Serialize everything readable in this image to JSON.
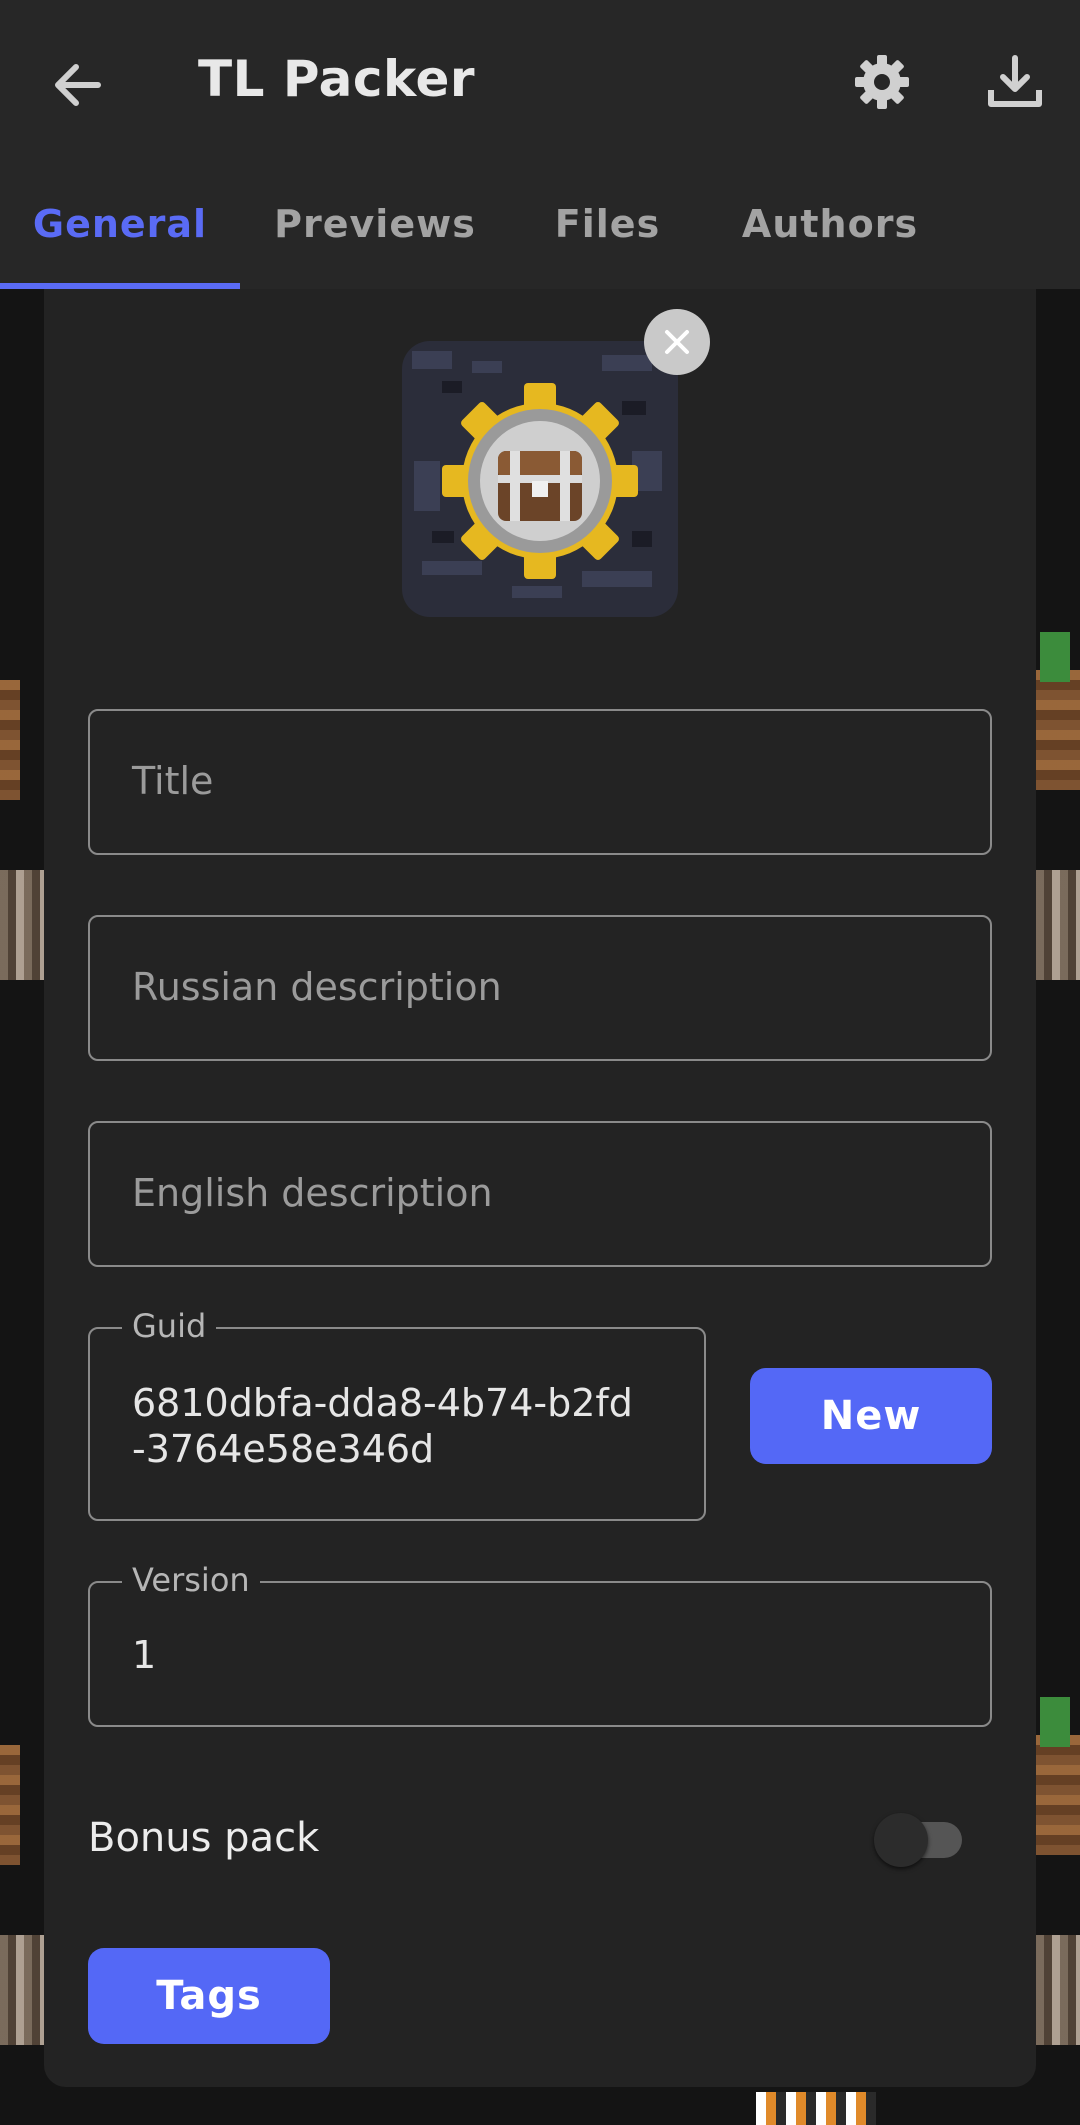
{
  "appbar": {
    "title": "TL Packer",
    "icons": [
      "back-arrow-icon",
      "gear-icon",
      "download-icon"
    ]
  },
  "tabs": [
    {
      "label": "General",
      "active": true
    },
    {
      "label": "Previews",
      "active": false
    },
    {
      "label": "Files",
      "active": false
    },
    {
      "label": "Authors",
      "active": false
    }
  ],
  "form": {
    "title_placeholder": "Title",
    "russian_description_placeholder": "Russian description",
    "english_description_placeholder": "English description",
    "guid_label": "Guid",
    "guid_line1": "6810dbfa-dda8-4b74-b2fd",
    "guid_line2": "-3764e58e346d",
    "new_button": "New",
    "version_label": "Version",
    "version_value": "1",
    "bonus_pack_label": "Bonus pack",
    "bonus_pack_enabled": false,
    "tags_button": "Tags"
  },
  "colors": {
    "accent": "#5468f6",
    "tab_active": "#5a6bf5",
    "background": "#141414",
    "card": "#232323",
    "appbar": "#272727"
  }
}
